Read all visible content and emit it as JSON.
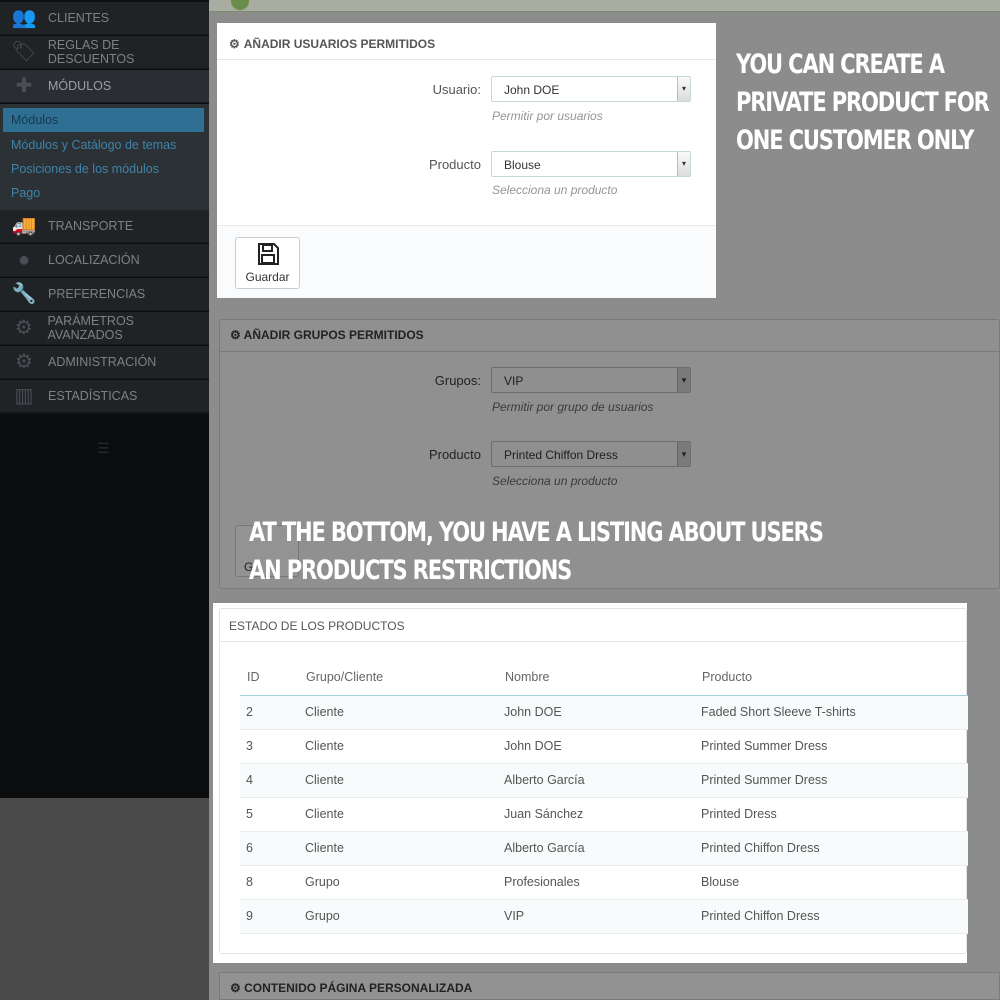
{
  "sidebar": {
    "items_top": [
      {
        "label": "Clientes",
        "icon": "users-icon"
      },
      {
        "label": "Reglas de descuentos",
        "icon": "tag-icon"
      },
      {
        "label": "Módulos",
        "icon": "puzzle-icon"
      }
    ],
    "submenu": [
      "Módulos",
      "Módulos y Catálogo de temas",
      "Posiciones de los módulos",
      "Pago"
    ],
    "items_bottom": [
      {
        "label": "Transporte",
        "icon": "truck-icon"
      },
      {
        "label": "Localización",
        "icon": "globe-icon"
      },
      {
        "label": "Preferencias",
        "icon": "wrench-icon"
      },
      {
        "label": "Parámetros avanzados",
        "icon": "gears-icon"
      },
      {
        "label": "Administración",
        "icon": "gear-icon"
      },
      {
        "label": "Estadísticas",
        "icon": "bar-chart-icon"
      }
    ]
  },
  "users_panel": {
    "title": "Añadir usuarios permitidos",
    "user_label": "Usuario:",
    "user_value": "John DOE",
    "user_help": "Permitir por usuarios",
    "product_label": "Producto",
    "product_value": "Blouse",
    "product_help": "Selecciona un producto",
    "save_label": "Guardar"
  },
  "groups_panel": {
    "title": "Añadir grupos permitidos",
    "groups_label": "Grupos:",
    "groups_value": "VIP",
    "groups_help": "Permitir por grupo de usuarios",
    "product_label": "Producto",
    "product_value": "Printed Chiffon Dress",
    "product_help": "Selecciona un producto",
    "save_partial": "G"
  },
  "status_panel": {
    "title": "Estado de los productos",
    "columns": [
      "ID",
      "Grupo/Cliente",
      "Nombre",
      "Producto"
    ],
    "rows": [
      [
        "2",
        "Cliente",
        "John DOE",
        "Faded Short Sleeve T-shirts"
      ],
      [
        "3",
        "Cliente",
        "John DOE",
        "Printed Summer Dress"
      ],
      [
        "4",
        "Cliente",
        "Alberto García",
        "Printed Summer Dress"
      ],
      [
        "5",
        "Cliente",
        "Juan Sánchez",
        "Printed Dress"
      ],
      [
        "6",
        "Cliente",
        "Alberto García",
        "Printed Chiffon Dress"
      ],
      [
        "8",
        "Grupo",
        "Profesionales",
        "Blouse"
      ],
      [
        "9",
        "Grupo",
        "VIP",
        "Printed Chiffon Dress"
      ]
    ]
  },
  "bottom_panel_title": "Contenido página personalizada",
  "captions": {
    "top": [
      "You can create a",
      "private product for",
      "one customer only"
    ],
    "bottom": [
      "At the bottom, you have a listing about users",
      "an products restrictions"
    ]
  }
}
